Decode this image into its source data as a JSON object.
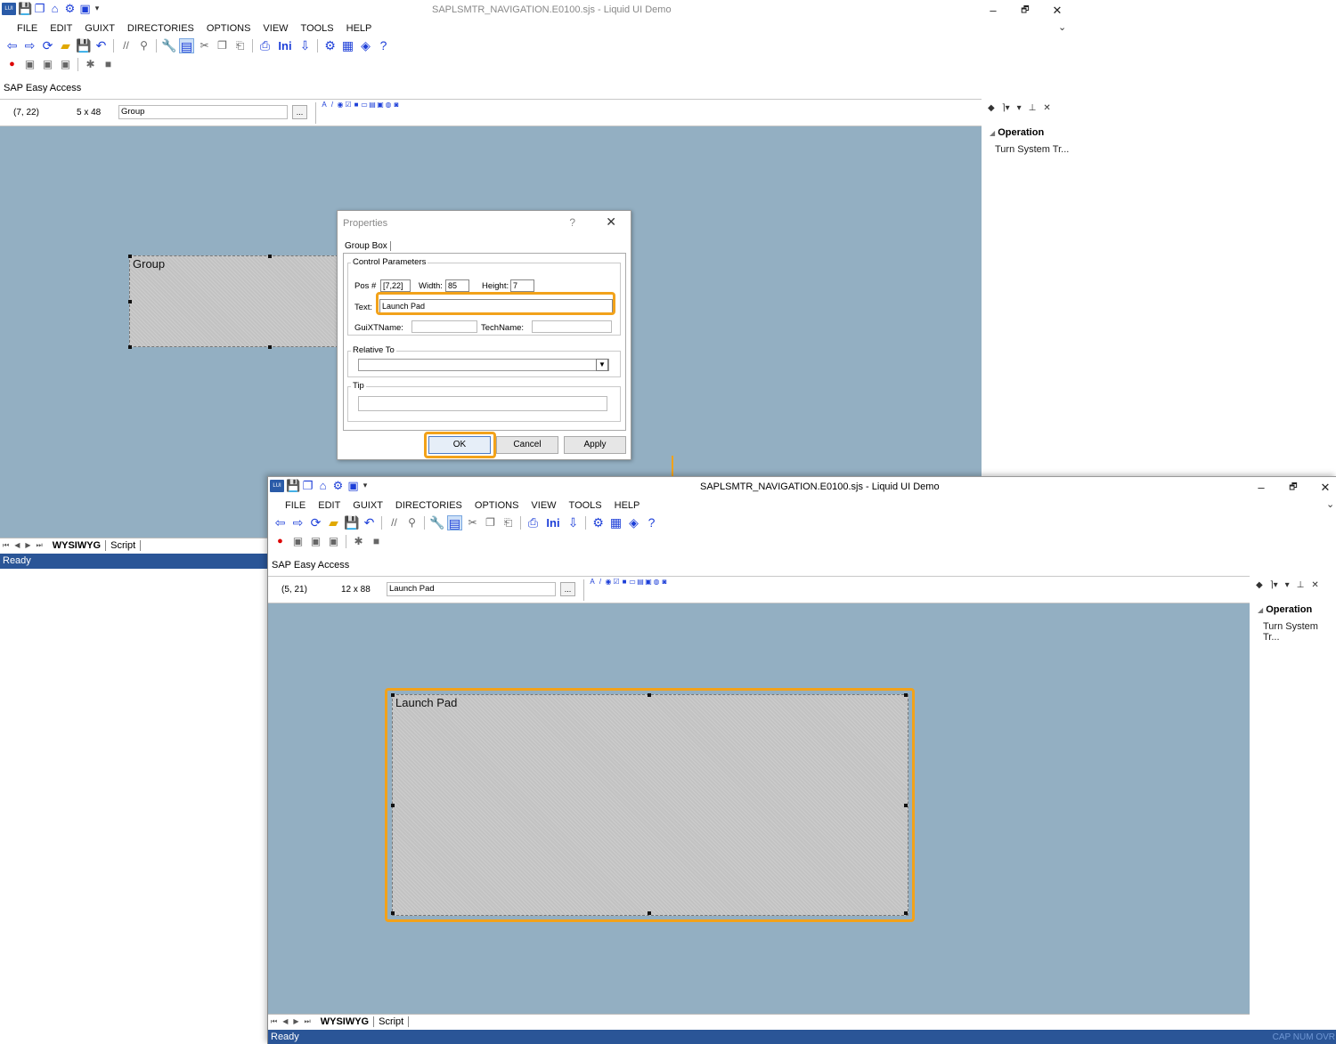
{
  "window_title": "SAPLSMTR_NAVIGATION.E0100.sjs - Liquid UI Demo",
  "window_controls": {
    "minimize": "–",
    "restore": "🗗",
    "close": "✕",
    "expand": "⌄"
  },
  "qat_dropdown": "▾",
  "menu": [
    "FILE",
    "EDIT",
    "GUIXT",
    "DIRECTORIES",
    "OPTIONS",
    "VIEW",
    "TOOLS",
    "HELP"
  ],
  "toolbar_ini": "Ini",
  "sap_title": "SAP Easy Access",
  "before": {
    "pos": "(7, 22)",
    "size": "5 x 48",
    "text_field": "Group",
    "group_label": "Group"
  },
  "after": {
    "pos": "(5, 21)",
    "size": "12 x 88",
    "text_field": "Launch Pad",
    "group_label": "Launch Pad"
  },
  "browse_button": "...",
  "side_panel": {
    "section": "Operation",
    "item": "Turn System Tr..."
  },
  "tabs": [
    "WYSIWYG",
    "Script"
  ],
  "status": "Ready",
  "status_indicators": "CAP NUM OVR",
  "dialog": {
    "title": "Properties",
    "help": "?",
    "close": "✕",
    "tab": "Group Box",
    "control_parameters": "Control Parameters",
    "pos_label": "Pos #",
    "pos_value": "[7,22]",
    "width_label": "Width:",
    "width_value": "85",
    "height_label": "Height:",
    "height_value": "7",
    "text_label": "Text:",
    "text_value": "Launch Pad",
    "guixtname_label": "GuiXTName:",
    "guixtname_value": "",
    "techname_label": "TechName:",
    "techname_value": "",
    "relative_to": "Relative To",
    "tip": "Tip",
    "ok": "OK",
    "cancel": "Cancel",
    "apply": "Apply"
  },
  "colors": {
    "canvas": "#93afc2",
    "highlight": "#f2a21a",
    "status": "#2a5597",
    "icon_blue": "#1d3fd8"
  }
}
